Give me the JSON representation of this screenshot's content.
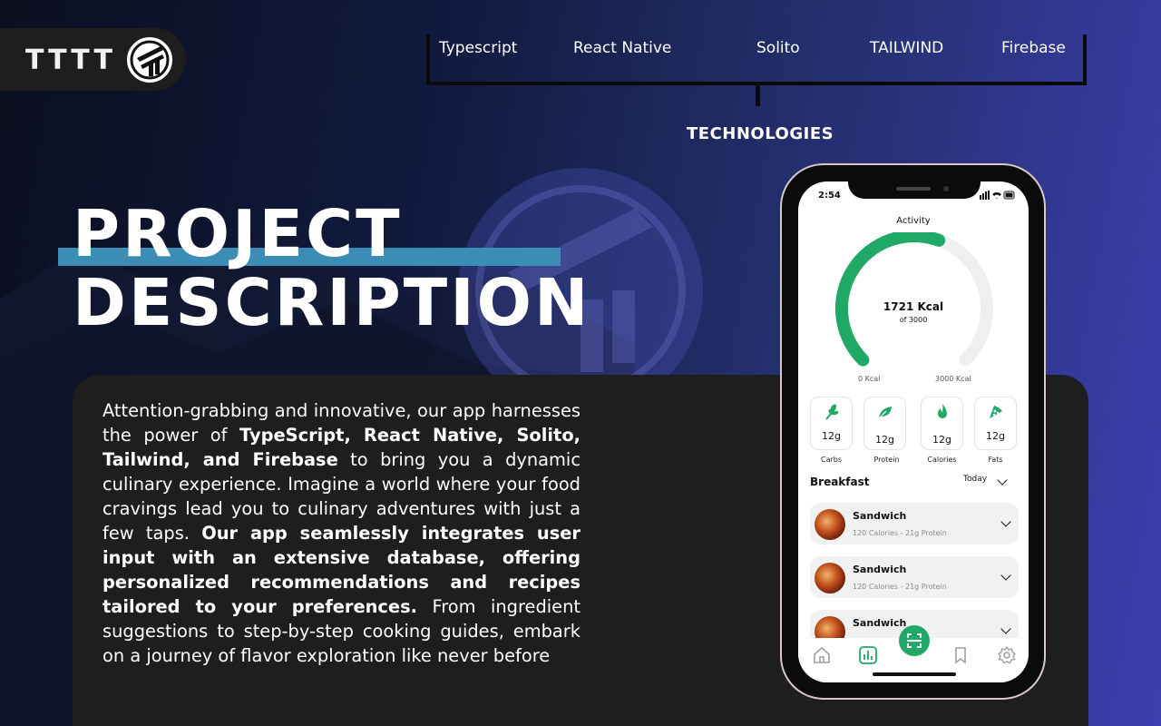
{
  "brand": {
    "logo_text": "TTTT"
  },
  "technologies": {
    "title": "TECHNOLOGIES",
    "items": [
      "Typescript",
      "React Native",
      "Solito",
      "TAILWIND",
      "Firebase"
    ]
  },
  "hero": {
    "line1": "PROJECT",
    "line2": "DESCRIPTION"
  },
  "description": {
    "p1": "Attention-grabbing and innovative, our app harnesses the power of ",
    "b1": "TypeScript, React Native, Solito, Tailwind, and Firebase",
    "p2": " to bring you a dynamic culinary experience. Imagine a world where your food cravings lead you to culinary adventures with just a few taps. ",
    "b2": "Our app seamlessly integrates user input with an extensive database, offering personalized recommendations and recipes tailored to your preferences.",
    "p3": " From ingredient suggestions to step-by-step cooking guides, embark on a journey of flavor exploration like never before"
  },
  "phone": {
    "time": "2:54",
    "screen_title": "Activity",
    "gauge": {
      "value": 1721,
      "max": 3000,
      "value_label": "1721 Kcal",
      "of_label": "of 3000",
      "min_label": "0 Kcal",
      "max_label": "3000 Kcal"
    },
    "macros": [
      {
        "label": "Carbs",
        "value": "12g",
        "icon": "wheat-icon"
      },
      {
        "label": "Protein",
        "value": "12g",
        "icon": "leaf-icon"
      },
      {
        "label": "Calories",
        "value": "12g",
        "icon": "flame-icon"
      },
      {
        "label": "Fats",
        "value": "12g",
        "icon": "pizza-icon"
      }
    ],
    "meal": {
      "title": "Breakfast",
      "filter": "Today"
    },
    "foods": [
      {
        "name": "Sandwich",
        "meta": "120 Calories  - 21g Protein"
      },
      {
        "name": "Sandwich",
        "meta": "120 Calories  - 21g Protein"
      },
      {
        "name": "Sandwich",
        "meta": ""
      }
    ],
    "tabs": [
      "home-icon",
      "stats-icon",
      "scan-icon",
      "bookmark-icon",
      "settings-icon"
    ],
    "accent": "#1fa866"
  }
}
